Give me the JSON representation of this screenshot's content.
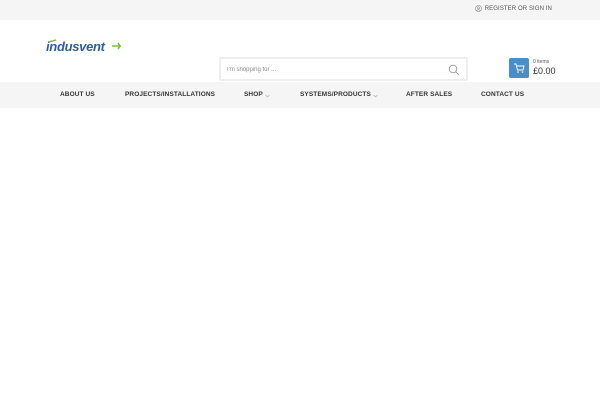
{
  "topbar": {
    "account_label": "REGISTER OR SIGN IN"
  },
  "search": {
    "placeholder": "I'm shopping for ..."
  },
  "cart": {
    "count_label": "0 items",
    "total": "£0.00"
  },
  "nav": {
    "items": [
      {
        "label": "ABOUT US"
      },
      {
        "label": "PROJECTS/INSTALLATIONS"
      },
      {
        "label": "SHOP"
      },
      {
        "label": "SYSTEMS/PRODUCTS"
      },
      {
        "label": "AFTER SALES"
      },
      {
        "label": "CONTACT US"
      }
    ]
  },
  "colors": {
    "accent": "#4a8ec7",
    "logo_blue": "#2f5d9e",
    "logo_green": "#7fbf3f",
    "bar_bg": "#f5f5f5"
  },
  "icons": {
    "account": "user-icon",
    "search": "search-icon",
    "cart": "cart-icon",
    "dropdown": "chevron-down-icon"
  }
}
